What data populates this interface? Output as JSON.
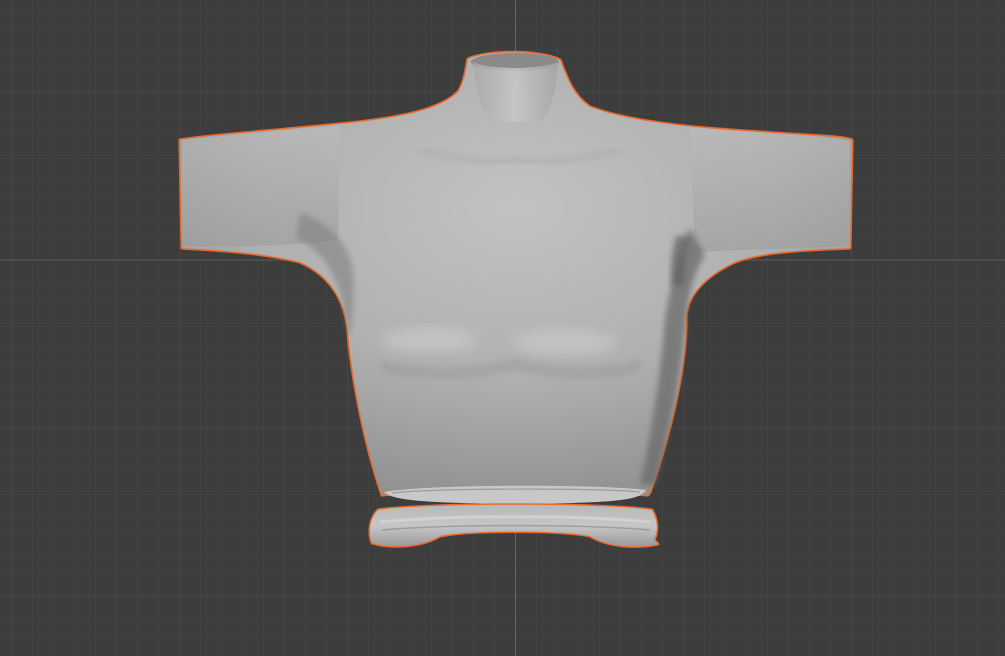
{
  "viewport": {
    "background_color": "#3d3d3d",
    "grid_minor_color": "#464646",
    "grid_major_color": "#525252",
    "axis_z_color": "#4a6f9c",
    "axis_x_color": "#5a5a5a",
    "selection_outline_color": "#e8692a",
    "mesh_base_color": "#aeaeae",
    "mesh_highlight_color": "#c4c4c4",
    "mesh_shadow_color": "#7c7c7c"
  },
  "scene": {
    "objects": [
      {
        "name_icon": "torso-mesh",
        "selected": true
      },
      {
        "name_icon": "waistband-ring-mesh",
        "selected": true
      }
    ]
  }
}
